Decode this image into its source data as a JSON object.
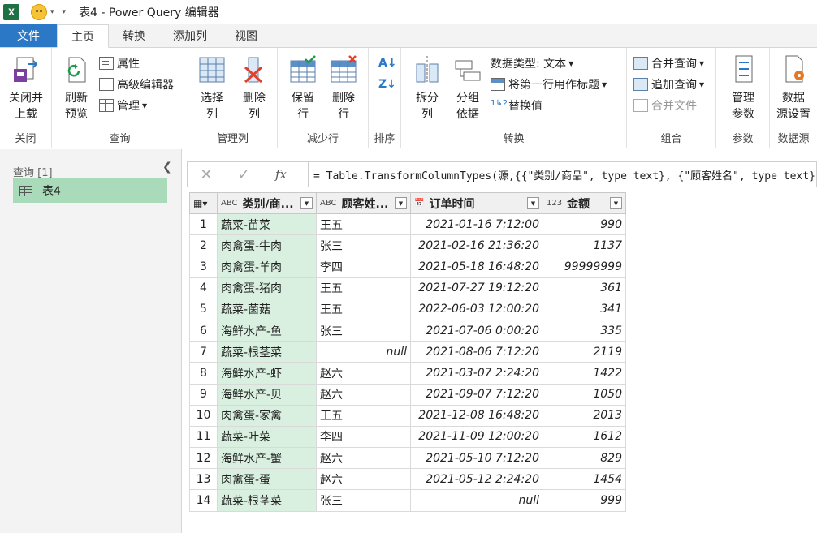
{
  "window": {
    "title": "表4 - Power Query 编辑器"
  },
  "tabs": [
    "文件",
    "主页",
    "转换",
    "添加列",
    "视图"
  ],
  "ribbon": {
    "close": {
      "btn": "关闭并\n上载",
      "label": "关闭"
    },
    "query": {
      "refresh": "刷新\n预览",
      "properties": "属性",
      "advanced_editor": "高级编辑器",
      "manage": "管理",
      "label": "查询"
    },
    "manage_cols": {
      "choose": "选择\n列",
      "remove": "删除\n列",
      "label": "管理列"
    },
    "reduce_rows": {
      "keep": "保留\n行",
      "remove": "删除\n行",
      "label": "减少行"
    },
    "sort": {
      "label": "排序"
    },
    "transform": {
      "split": "拆分\n列",
      "group": "分组\n依据",
      "data_type": "数据类型: 文本",
      "first_row_header": "将第一行用作标题",
      "replace": "替换值",
      "label": "转换"
    },
    "combine": {
      "merge": "合并查询",
      "append": "追加查询",
      "combine_files": "合并文件",
      "label": "组合"
    },
    "params": {
      "manage": "管理\n参数",
      "label": "参数"
    },
    "datasource": {
      "settings": "数据\n源设置",
      "label": "数据源"
    }
  },
  "queries": {
    "header": "查询 [1]",
    "items": [
      "表4"
    ]
  },
  "formula": "= Table.TransformColumnTypes(源,{{\"类别/商品\", type text}, {\"顾客姓名\", type text}",
  "columns": [
    {
      "type": "ABC",
      "name": "类别/商..."
    },
    {
      "type": "ABC",
      "name": "顾客姓..."
    },
    {
      "type": "date",
      "name": "订单时间"
    },
    {
      "type": "123",
      "name": "金额"
    }
  ],
  "rows": [
    [
      "1",
      "蔬菜-苗菜",
      "王五",
      "2021-01-16 7:12:00",
      "990"
    ],
    [
      "2",
      "肉禽蛋-牛肉",
      "张三",
      "2021-02-16 21:36:20",
      "1137"
    ],
    [
      "3",
      "肉禽蛋-羊肉",
      "李四",
      "2021-05-18 16:48:20",
      "99999999"
    ],
    [
      "4",
      "肉禽蛋-猪肉",
      "王五",
      "2021-07-27 19:12:20",
      "361"
    ],
    [
      "5",
      "蔬菜-菌菇",
      "王五",
      "2022-06-03 12:00:20",
      "341"
    ],
    [
      "6",
      "海鲜水产-鱼",
      "张三",
      "2021-07-06 0:00:20",
      "335"
    ],
    [
      "7",
      "蔬菜-根茎菜",
      "null",
      "2021-08-06 7:12:20",
      "2119"
    ],
    [
      "8",
      "海鲜水产-虾",
      "赵六",
      "2021-03-07 2:24:20",
      "1422"
    ],
    [
      "9",
      "海鲜水产-贝",
      "赵六",
      "2021-09-07 7:12:20",
      "1050"
    ],
    [
      "10",
      "肉禽蛋-家禽",
      "王五",
      "2021-12-08 16:48:20",
      "2013"
    ],
    [
      "11",
      "蔬菜-叶菜",
      "李四",
      "2021-11-09 12:00:20",
      "1612"
    ],
    [
      "12",
      "海鲜水产-蟹",
      "赵六",
      "2021-05-10 7:12:20",
      "829"
    ],
    [
      "13",
      "肉禽蛋-蛋",
      "赵六",
      "2021-05-12 2:24:20",
      "1454"
    ],
    [
      "14",
      "蔬菜-根茎菜",
      "张三",
      "null",
      "999"
    ]
  ]
}
